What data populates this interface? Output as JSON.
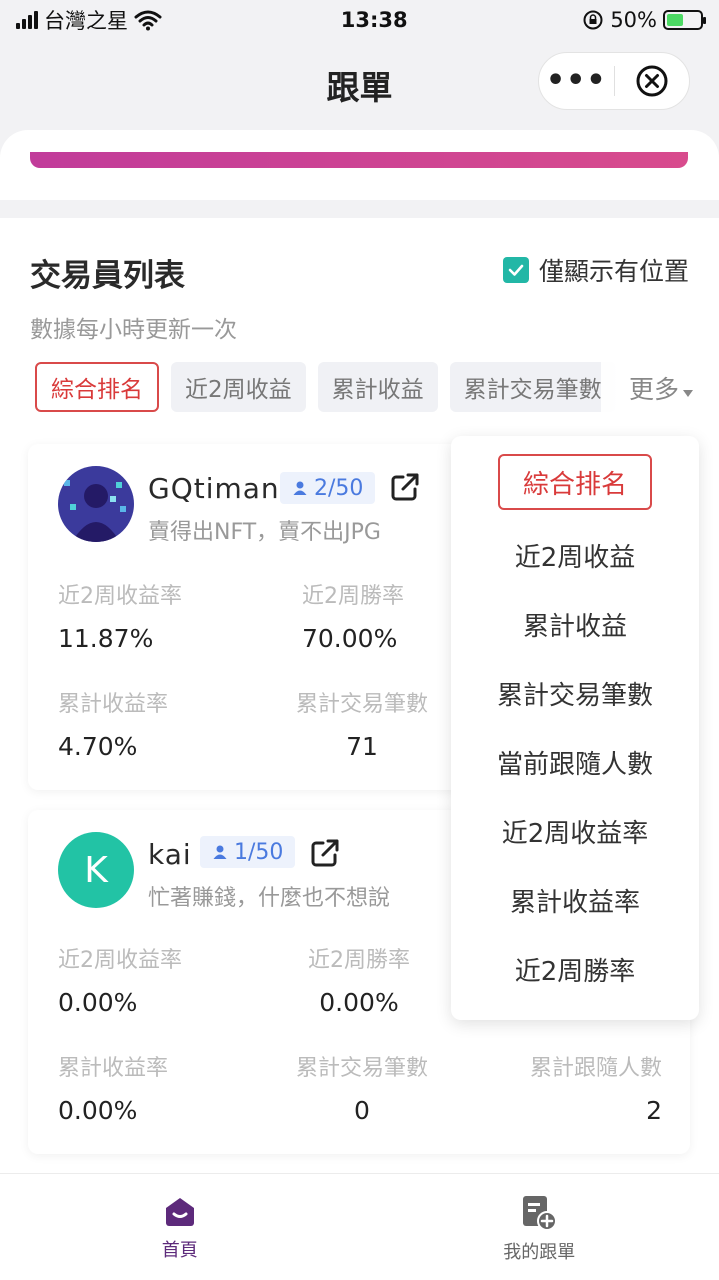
{
  "status_bar": {
    "carrier": "台灣之星",
    "time": "13:38",
    "battery": "50%",
    "battery_level": 0.5
  },
  "nav": {
    "title": "跟單"
  },
  "section": {
    "title": "交易員列表",
    "subtitle": "數據每小時更新一次",
    "only_positions_label": "僅顯示有位置",
    "only_positions_checked": true
  },
  "tabs": {
    "items": [
      "綜合排名",
      "近2周收益",
      "累計收益",
      "累計交易筆數"
    ],
    "active": "綜合排名",
    "more_label": "更多"
  },
  "traders": [
    {
      "name": "GQtiman",
      "followers": "2/50",
      "desc": "賣得出NFT，賣不出JPG",
      "stats": [
        {
          "label": "近2周收益率",
          "value": "11.87%"
        },
        {
          "label": "近2周勝率",
          "value": "70.00%"
        },
        {
          "label": "累計收益率",
          "value": "4.70%"
        },
        {
          "label": "累計交易筆數",
          "value": "71"
        }
      ]
    },
    {
      "name": "kai",
      "avatar_letter": "K",
      "followers": "1/50",
      "desc": "忙著賺錢，什麼也不想說",
      "stats": [
        {
          "label": "近2周收益率",
          "value": "0.00%"
        },
        {
          "label": "近2周勝率",
          "value": "0.00%"
        },
        {
          "label": "累計收益率",
          "value": "0.00%"
        },
        {
          "label": "累計交易筆數",
          "value": "0"
        },
        {
          "label": "累計跟隨人數",
          "value": "2"
        }
      ]
    }
  ],
  "dropdown": {
    "items": [
      "綜合排名",
      "近2周收益",
      "累計收益",
      "累計交易筆數",
      "當前跟隨人數",
      "近2周收益率",
      "累計收益率",
      "近2周勝率"
    ]
  },
  "tabbar": [
    {
      "label": "首頁",
      "icon": "home-icon",
      "active": true
    },
    {
      "label": "我的跟單",
      "icon": "document-add-icon",
      "active": false
    }
  ],
  "colors": {
    "accent_red": "#d93a3a",
    "brand_purple": "#5d2a7b",
    "teal": "#22b7a6",
    "badge_blue": "#4a7adf"
  }
}
